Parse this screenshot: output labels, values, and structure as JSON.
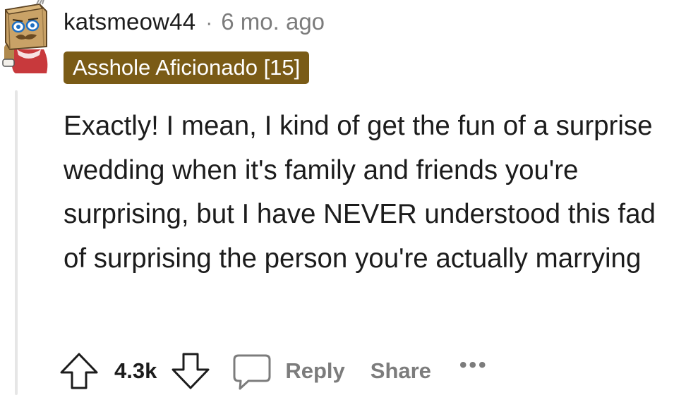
{
  "comment": {
    "author": "katsmeow44",
    "separator": "·",
    "timestamp": "6 mo. ago",
    "flair": "Asshole Aficionado [15]",
    "body": "Exactly! I mean, I kind of get the fun of a surprise wedding when it's family and friends you're surprising, but I have NEVER understood this fad of surprising the person you're actually marrying"
  },
  "actions": {
    "upvote_icon": "arrow-up-icon",
    "score": "4.3k",
    "downvote_icon": "arrow-down-icon",
    "reply_icon": "speech-bubble-icon",
    "reply_label": "Reply",
    "share_label": "Share",
    "more_label": "•••"
  },
  "colors": {
    "flair_background": "#7a5b16",
    "flair_text": "#ffffff",
    "muted_text": "#7c7c7c",
    "thread_line": "#e6e6e6"
  }
}
